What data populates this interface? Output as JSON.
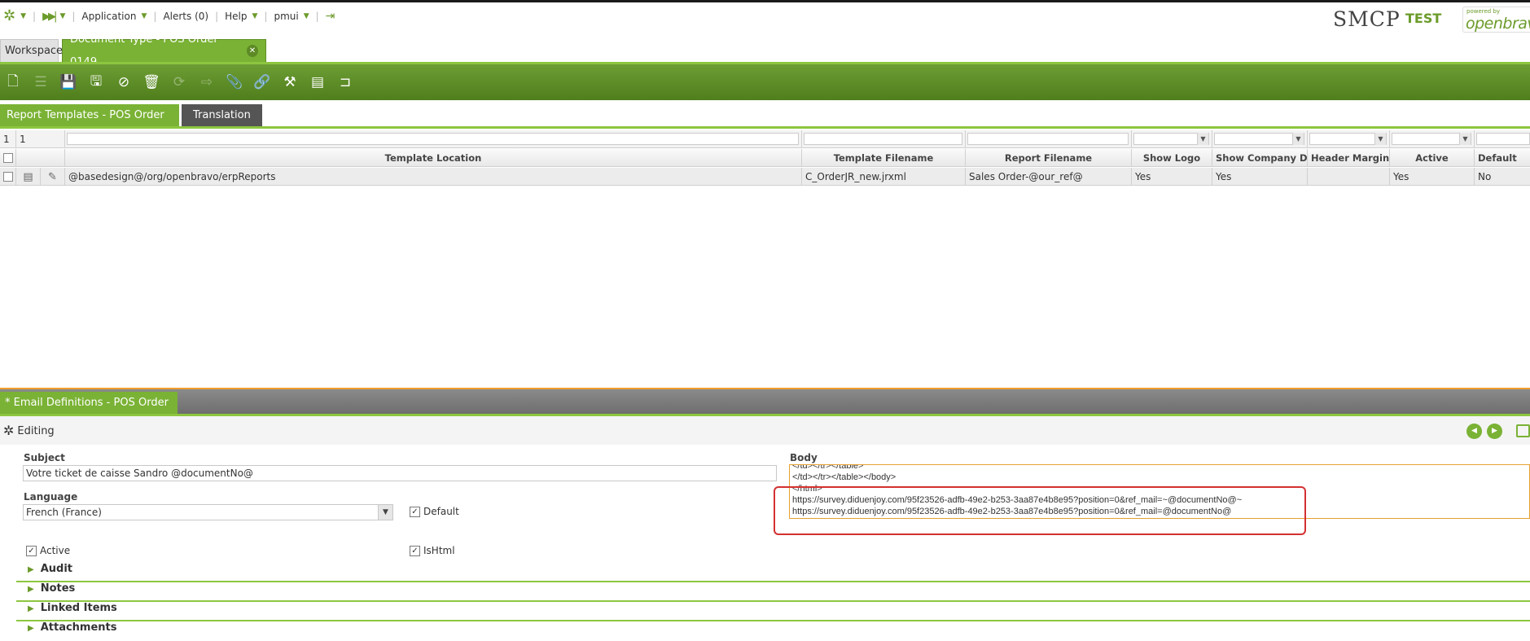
{
  "nav": {
    "application": "Application",
    "alerts": "Alerts (0)",
    "help": "Help",
    "user": "pmui"
  },
  "brand": {
    "name": "SMCP",
    "env": "TEST",
    "powered": "powered by",
    "logo_word": "openbravo"
  },
  "tabs": {
    "workspace": "Workspace",
    "document": "Document Type - POS Order 0149...",
    "close": "✕"
  },
  "subtabs": {
    "report_templates": "Report Templates - POS Order R...",
    "translation": "Translation"
  },
  "grid": {
    "counts": [
      "1",
      "1"
    ],
    "headers": {
      "template_location": "Template Location",
      "template_filename": "Template Filename",
      "report_filename": "Report Filename",
      "show_logo": "Show Logo",
      "show_company_data": "Show Company Data",
      "header_margin": "Header Margin",
      "active": "Active",
      "default": "Default"
    },
    "row": {
      "template_location": "@basedesign@/org/openbravo/erpReports",
      "template_filename": "C_OrderJR_new.jrxml",
      "report_filename": "Sales Order-@our_ref@",
      "show_logo": "Yes",
      "show_company_data": "Yes",
      "header_margin": "",
      "active": "Yes",
      "default": "No"
    }
  },
  "email": {
    "tab_label": "* Email Definitions - POS Order ...",
    "editing": "Editing",
    "subject_label": "Subject",
    "subject_value": "Votre ticket de caisse Sandro @documentNo@",
    "language_label": "Language",
    "language_value": "French (France)",
    "default_label": "Default",
    "active_label": "Active",
    "ishtml_label": "IsHtml",
    "body_label": "Body",
    "body_lines": [
      "</td></tr></table>",
      "</td></tr></table></body>",
      "</html>",
      "https://survey.diduenjoy.com/95f23526-adfb-49e2-b253-3aa87e4b8e95?position=0&ref_mail=~@documentNo@~",
      "https://survey.diduenjoy.com/95f23526-adfb-49e2-b253-3aa87e4b8e95?position=0&ref_mail=@documentNo@"
    ]
  },
  "sections": [
    "Audit",
    "Notes",
    "Linked Items",
    "Attachments"
  ],
  "colors": {
    "accent": "#7ab235",
    "toolbar": "#5a8a24",
    "highlight": "#d43030"
  }
}
